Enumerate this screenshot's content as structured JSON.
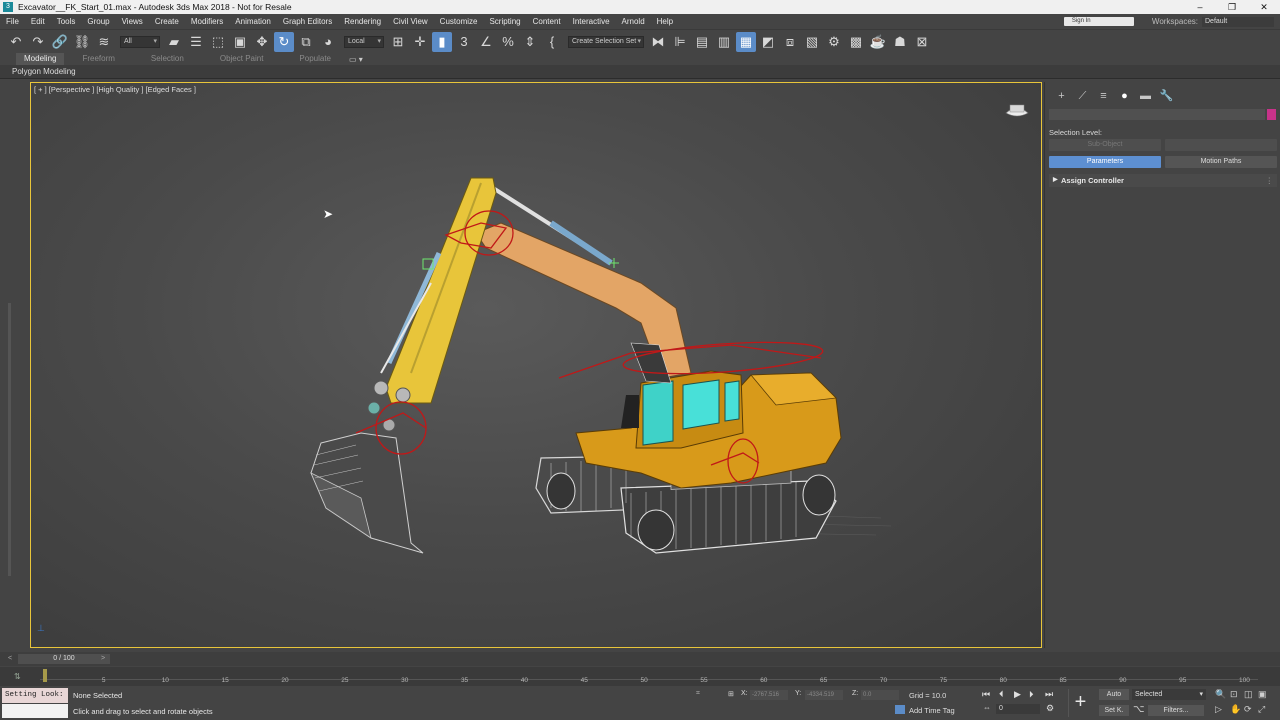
{
  "window": {
    "title": "Excavator__FK_Start_01.max - Autodesk 3ds Max 2018 - Not for Resale",
    "app_icon": "3"
  },
  "menu": [
    "File",
    "Edit",
    "Tools",
    "Group",
    "Views",
    "Create",
    "Modifiers",
    "Animation",
    "Graph Editors",
    "Rendering",
    "Civil View",
    "Customize",
    "Scripting",
    "Content",
    "Interactive",
    "Arnold",
    "Help"
  ],
  "signin": "Sign In",
  "workspaces": {
    "label": "Workspaces:",
    "value": "Default"
  },
  "toolbar": {
    "selection_filter": "All",
    "ref_coord": "Local",
    "named_selection": "Create Selection Set"
  },
  "ribbon": {
    "tabs": [
      "Modeling",
      "Freeform",
      "Selection",
      "Object Paint",
      "Populate"
    ],
    "active_tab": "Modeling",
    "panel_label": "Polygon Modeling"
  },
  "viewport": {
    "label": "[ + ] [Perspective ] [High Quality ] [Edged Faces ]",
    "colors": {
      "border": "#e8c53a",
      "arm": "#e8c53a",
      "boom": "#e0a060",
      "body": "#d89a1a",
      "glass": "#40d0c8",
      "controller": "#c01818"
    }
  },
  "command_panel": {
    "selection_level": "Selection Level:",
    "sub_object": "Sub-Object",
    "parameters": "Parameters",
    "motion_paths": "Motion Paths",
    "rollout": "Assign Controller",
    "color_swatch": "#c8328a"
  },
  "timeslider": {
    "value": "0 / 100"
  },
  "trackbar": {
    "ticks": [
      "5",
      "10",
      "15",
      "20",
      "25",
      "30",
      "35",
      "40",
      "45",
      "50",
      "55",
      "60",
      "65",
      "70",
      "75",
      "80",
      "85",
      "90",
      "95",
      "100"
    ]
  },
  "status": {
    "maxscript": "Setting Look:",
    "selection": "None Selected",
    "prompt": "Click and drag to select and rotate objects",
    "x_label": "X:",
    "x_value": "-2767.516",
    "y_label": "Y:",
    "y_value": "-4334.519",
    "z_label": "Z:",
    "z_value": "0.0",
    "grid": "Grid = 10.0",
    "add_time_tag": "Add Time Tag",
    "frame": "0",
    "auto_key": "Auto",
    "set_key": "Set K.",
    "key_mode": "Selected",
    "filters": "Filters..."
  }
}
